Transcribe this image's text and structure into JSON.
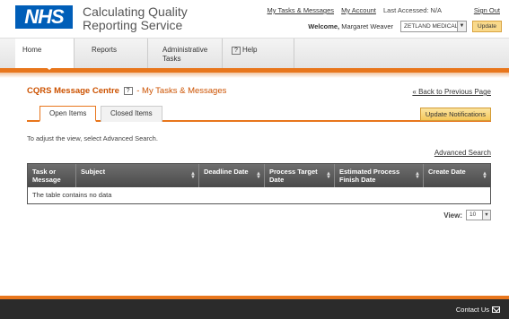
{
  "header": {
    "logo_text": "NHS",
    "title_line1": "Calculating Quality",
    "title_line2": "Reporting Service",
    "link_tasks": "My Tasks & Messages",
    "link_account": "My Account",
    "last_accessed": "Last Accessed: N/A",
    "link_signout": "Sign Out",
    "welcome_label": "Welcome,",
    "welcome_user": "Margaret Weaver",
    "org_selected": "ZETLAND MEDICAL",
    "update_button": "Update"
  },
  "nav": {
    "items": [
      {
        "label": "Home"
      },
      {
        "label": "Reports"
      },
      {
        "label": "Administrative Tasks"
      },
      {
        "label": "Help"
      }
    ]
  },
  "page": {
    "title": "CQRS Message Centre",
    "help_glyph": "?",
    "subtitle": "- My Tasks & Messages",
    "back_link": "« Back to Previous Page",
    "tabs": [
      {
        "label": "Open Items"
      },
      {
        "label": "Closed Items"
      }
    ],
    "update_notifications": "Update Notifications",
    "hint": "To adjust the view, select Advanced Search.",
    "advanced_search": "Advanced Search",
    "table": {
      "columns": [
        "Task or Message",
        "Subject",
        "Deadline Date",
        "Process Target Date",
        "Estimated Process Finish Date",
        "Create Date"
      ],
      "empty_message": "The table contains no data"
    },
    "view_label": "View:",
    "view_value": "10"
  },
  "footer": {
    "contact": "Contact Us"
  },
  "colors": {
    "accent": "#e8761c",
    "nhs_blue": "#005eb8",
    "title_orange": "#cc5200"
  },
  "icons": {
    "help": "help-icon",
    "sort": "sort-icon",
    "mail": "mail-icon"
  }
}
